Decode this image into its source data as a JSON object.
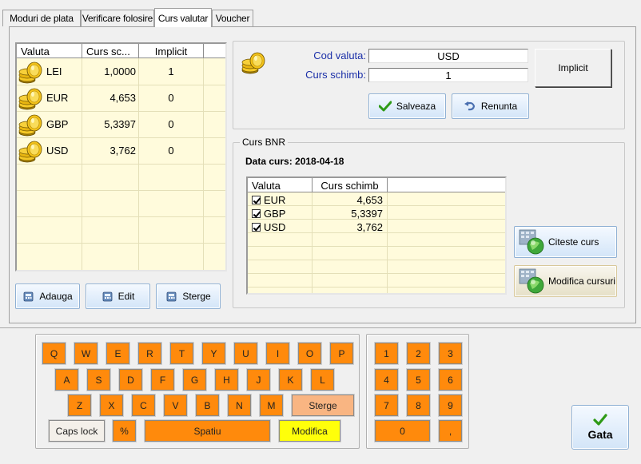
{
  "tabs": [
    {
      "label": "Moduri de plata"
    },
    {
      "label": "Verificare folosire"
    },
    {
      "label": "Curs valutar"
    },
    {
      "label": "Voucher"
    }
  ],
  "currency_grid": {
    "headers": [
      "Valuta",
      "Curs sc...",
      "Implicit"
    ],
    "rows": [
      {
        "code": "LEI",
        "rate": "1,0000",
        "implicit": "1"
      },
      {
        "code": "EUR",
        "rate": "4,653",
        "implicit": "0"
      },
      {
        "code": "GBP",
        "rate": "5,3397",
        "implicit": "0"
      },
      {
        "code": "USD",
        "rate": "3,762",
        "implicit": "0"
      }
    ]
  },
  "left_buttons": {
    "add": "Adauga",
    "edit": "Edit",
    "delete": "Sterge"
  },
  "edit_form": {
    "code_label": "Cod valuta:",
    "code_value": "USD",
    "rate_label": "Curs schimb:",
    "rate_value": "1",
    "implicit_button": "Implicit",
    "save_button": "Salveaza",
    "cancel_button": "Renunta"
  },
  "bnr": {
    "group_title": "Curs BNR",
    "date_label": "Data curs:",
    "date_value": "2018-04-18",
    "headers": [
      "Valuta",
      "Curs schimb"
    ],
    "rows": [
      {
        "code": "EUR",
        "rate": "4,653"
      },
      {
        "code": "GBP",
        "rate": "5,3397"
      },
      {
        "code": "USD",
        "rate": "3,762"
      }
    ],
    "read_button": "Citeste curs",
    "modify_button": "Modifica cursuri"
  },
  "keyboard": {
    "row1": [
      "Q",
      "W",
      "E",
      "R",
      "T",
      "Y",
      "U",
      "I",
      "O",
      "P"
    ],
    "row2": [
      "A",
      "S",
      "D",
      "F",
      "G",
      "H",
      "J",
      "K",
      "L"
    ],
    "row3": [
      "Z",
      "X",
      "C",
      "V",
      "B",
      "N",
      "M"
    ],
    "delete": "Sterge",
    "caps": "Caps lock",
    "percent": "%",
    "space": "Spatiu",
    "modify": "Modifica"
  },
  "numpad": {
    "rows": [
      [
        "1",
        "2",
        "3"
      ],
      [
        "4",
        "5",
        "6"
      ],
      [
        "7",
        "8",
        "9"
      ]
    ],
    "zero": "0",
    "comma": ","
  },
  "done_button": "Gata",
  "colors": {
    "key_orange": "#ff8a0c",
    "key_light_orange": "#f9b582",
    "key_yellow": "#ffff0a",
    "grid_bg": "#fffbdc",
    "label_blue": "#1b2fa8"
  }
}
